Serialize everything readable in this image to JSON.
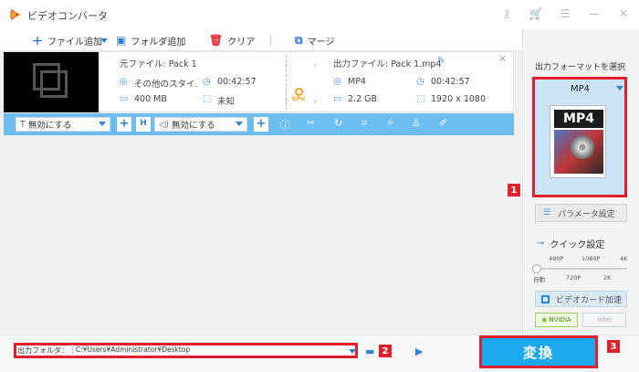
{
  "window": {
    "title": "ビデオコンバータ"
  },
  "toolbar": {
    "add_file": "ファイル追加",
    "add_folder": "フォルダ追加",
    "clear": "クリア",
    "merge": "マージ"
  },
  "file": {
    "source_label": "元ファイル: Pack 1",
    "source_format": "その他のスタイ.",
    "source_duration": "00:42:57",
    "source_size": "400 MB",
    "source_resolution": "未知",
    "output_label": "出力ファイル: Pack 1.mp4",
    "output_format": "MP4",
    "output_duration": "00:42:57",
    "output_size": "2.2 GB",
    "output_resolution": "1920 x 1080",
    "gpu_badge": "GPU"
  },
  "editbar": {
    "subtitle_select": "無効にする",
    "audio_select": "無効にする"
  },
  "right_panel": {
    "title": "出力フォーマットを選択",
    "format": "MP4",
    "format_icon_text": "MP4",
    "param_button": "パラメータ設定",
    "quick_title": "クイック設定",
    "quick_top_labels": [
      "480P",
      "1080P",
      "4K"
    ],
    "quick_bottom_labels": [
      "自動",
      "720P",
      "2K"
    ],
    "gpu_accel": "ビデオカード加速",
    "nvidia": "NVIDIA",
    "intel": "intel"
  },
  "bottom": {
    "output_folder_label": "出力フォルダ：",
    "output_path": "C:¥Users¥Administrator¥Desktop",
    "convert_button": "変換"
  },
  "badges": [
    "1",
    "2",
    "3"
  ],
  "colors": {
    "accent": "#1ea8f0",
    "highlight": "#e0202a",
    "editbar": "#6ebdf0"
  }
}
